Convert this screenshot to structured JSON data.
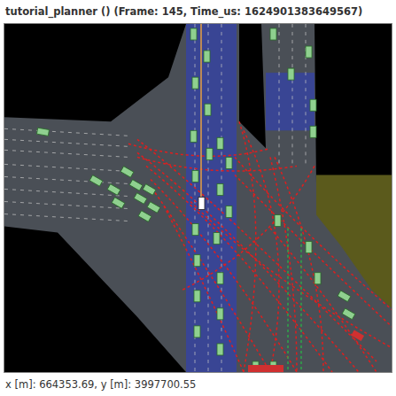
{
  "window": {
    "title": "tutorial_planner () (Frame: 145, Time_us: 1624901383649567)"
  },
  "status_bar": {
    "text": "x [m]: 664353.69, y [m]: 3997700.55"
  }
}
